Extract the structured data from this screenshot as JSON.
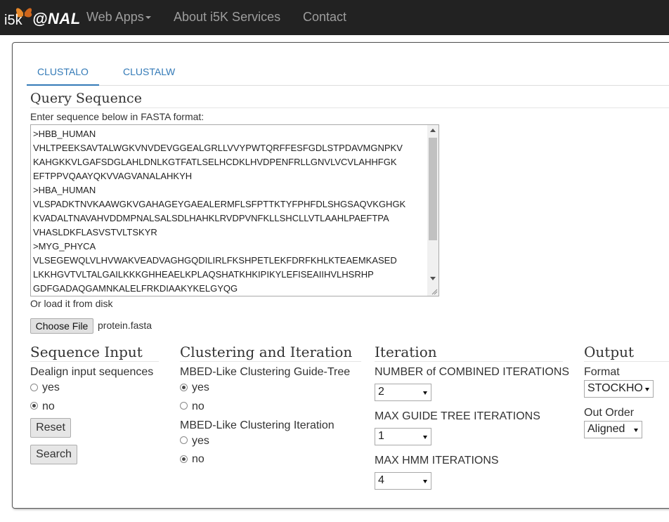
{
  "navbar": {
    "brand_prefix": "i5k",
    "brand_text": "@NAL",
    "links": [
      {
        "label": "Web Apps"
      },
      {
        "label": "About i5K Services"
      },
      {
        "label": "Contact"
      }
    ]
  },
  "tabs": [
    {
      "label": "CLUSTALO",
      "active": true
    },
    {
      "label": "CLUSTALW",
      "active": false
    }
  ],
  "query": {
    "title": "Query Sequence",
    "instruction": "Enter sequence below in FASTA format:",
    "sequence_lines": [
      ">HBB_HUMAN",
      "VHLTPEEKSAVTALWGKVNVDEVGGEALGRLLVVYPWTQRFFESFGDLSTPDAVMGNPKV",
      "KAHGKKVLGAFSDGLAHLDNLKGTFATLSELHCDKLHVDPENFRLLGNVLVCVLAHHFGK",
      "EFTPPVQAAYQKVVAGVANALAHKYH",
      ">HBA_HUMAN",
      "VLSPADKTNVKAAWGKVGAHAGEYGAEALERMFLSFPTTKTYFPHFDLSHGSAQVKGHGK",
      "KVADALTNAVAHVDDMPNALSALSDLHAHKLRVDPVNFKLLSHCLLVTLAAHLPAEFTPA",
      "VHASLDKFLASVSTVLTSKYR",
      ">MYG_PHYCA",
      "VLSEGEWQLVLHVWAKVEADVAGHGQDILIRLFKSHPETLEKFDRFKHLKTEAEMKASED",
      "LKKHGVTVLTALGAILKKKGHHEAELKPLAQSHATKHKIPIKYLEFISEAIIHVLHSRHP",
      "GDFGADAQGAMNKALELFRKDIAAKYKELGYQG"
    ],
    "load_from_disk": "Or load it from disk",
    "choose_file_label": "Choose File",
    "file_name": "protein.fasta"
  },
  "sequence_input": {
    "title": "Sequence Input",
    "dealign_label": "Dealign input sequences",
    "options": [
      {
        "label": "yes",
        "checked": false
      },
      {
        "label": "no",
        "checked": true
      }
    ],
    "reset_label": "Reset",
    "search_label": "Search"
  },
  "clustering": {
    "title": "Clustering and Iteration",
    "guide_tree_label": "MBED-Like Clustering Guide-Tree",
    "guide_tree_options": [
      {
        "label": "yes",
        "checked": true
      },
      {
        "label": "no",
        "checked": false
      }
    ],
    "iteration_label": "MBED-Like Clustering Iteration",
    "iteration_options": [
      {
        "label": "yes",
        "checked": false
      },
      {
        "label": "no",
        "checked": true
      }
    ]
  },
  "iteration": {
    "title": "Iteration",
    "combined_label": "NUMBER of COMBINED ITERATIONS",
    "combined_value": "2",
    "guide_tree_label": "MAX GUIDE TREE ITERATIONS",
    "guide_tree_value": "1",
    "hmm_label": "MAX HMM ITERATIONS",
    "hmm_value": "4"
  },
  "output": {
    "title": "Output",
    "format_label": "Format",
    "format_value": "STOCKHO",
    "order_label": "Out Order",
    "order_value": "Aligned"
  }
}
